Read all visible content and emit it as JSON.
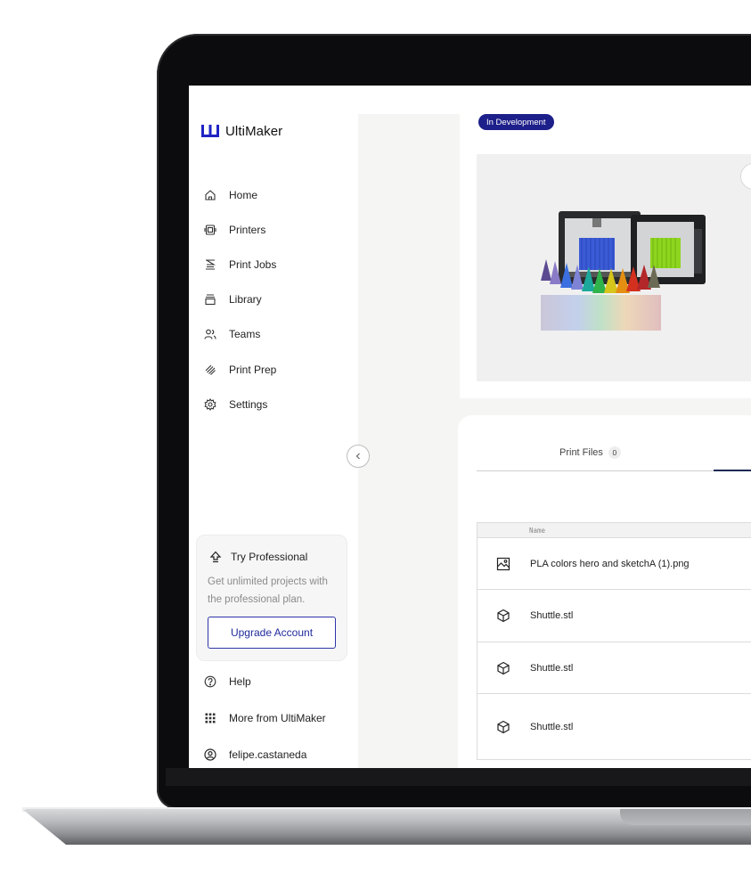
{
  "brand": {
    "name": "UltiMaker",
    "accent": "#1d1f8a",
    "logo_color": "#1f24c4"
  },
  "sidebar": {
    "items": [
      {
        "label": "Home",
        "icon": "home-icon"
      },
      {
        "label": "Printers",
        "icon": "printer-icon"
      },
      {
        "label": "Print Jobs",
        "icon": "print-jobs-icon"
      },
      {
        "label": "Library",
        "icon": "library-icon"
      },
      {
        "label": "Teams",
        "icon": "teams-icon"
      },
      {
        "label": "Print Prep",
        "icon": "print-prep-icon"
      },
      {
        "label": "Settings",
        "icon": "gear-icon"
      }
    ],
    "promo": {
      "title": "Try Professional",
      "description": "Get unlimited projects with the professional plan.",
      "button_label": "Upgrade Account"
    },
    "bottom_items": [
      {
        "label": "Help",
        "icon": "help-icon"
      },
      {
        "label": "More from UltiMaker",
        "icon": "apps-grid-icon"
      },
      {
        "label": "felipe.castaneda",
        "icon": "user-avatar-icon"
      }
    ]
  },
  "project": {
    "status_badge": "In Development"
  },
  "files": {
    "tab_label": "Print Files",
    "tab_count": "0",
    "column_name": "Name",
    "rows": [
      {
        "name": "PLA colors hero and sketchA (1).png",
        "icon": "image-file-icon"
      },
      {
        "name": "Shuttle.stl",
        "icon": "3d-model-icon"
      },
      {
        "name": "Shuttle.stl",
        "icon": "3d-model-icon"
      },
      {
        "name": "Shuttle.stl",
        "icon": "3d-model-icon"
      }
    ]
  }
}
